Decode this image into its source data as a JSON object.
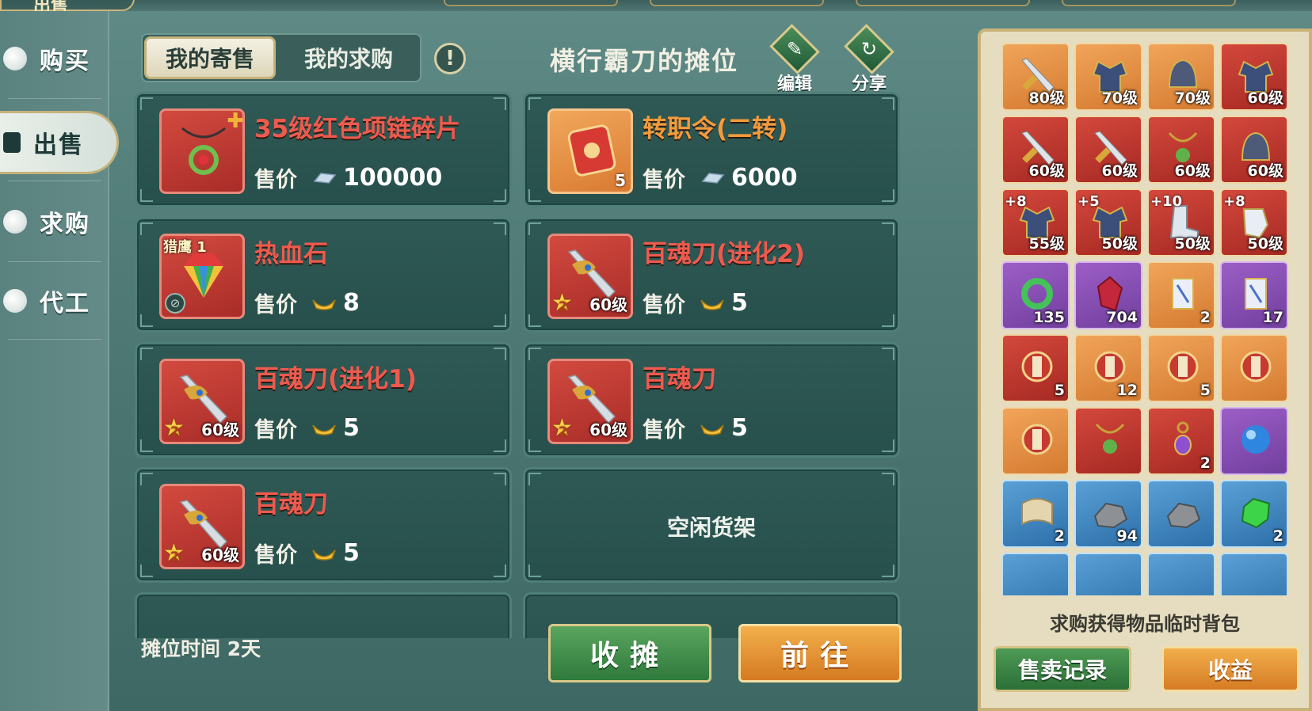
{
  "top_tab": "出售",
  "nav": [
    {
      "label": "购买"
    },
    {
      "label": "出售"
    },
    {
      "label": "求购"
    },
    {
      "label": "代工"
    }
  ],
  "tabs": {
    "my_sale": "我的寄售",
    "my_request": "我的求购"
  },
  "info": "!",
  "stall_title": "横行霸刀的摊位",
  "tools": {
    "edit": "编辑",
    "share": "分享"
  },
  "price_label": "售价",
  "listings": [
    {
      "name": "35级红色项链碎片",
      "price": "100000",
      "currency": "silver-ingot-icon"
    },
    {
      "name": "转职令(二转)",
      "price": "6000",
      "currency": "silver-ingot-icon",
      "count": "5"
    },
    {
      "name": "热血石",
      "price": "8",
      "currency": "gold-ingot-icon",
      "tag": "猎鹰 1"
    },
    {
      "name": "百魂刀(进化2)",
      "price": "5",
      "currency": "gold-ingot-icon",
      "level": "60级",
      "star": "2"
    },
    {
      "name": "百魂刀(进化1)",
      "price": "5",
      "currency": "gold-ingot-icon",
      "level": "60级",
      "star": "2"
    },
    {
      "name": "百魂刀",
      "price": "5",
      "currency": "gold-ingot-icon",
      "level": "60级",
      "star": "2"
    },
    {
      "name": "百魂刀",
      "price": "5",
      "currency": "gold-ingot-icon",
      "level": "60级",
      "star": "2"
    }
  ],
  "empty_shelf": "空闲货架",
  "stall_time": "摊位时间 2天",
  "buttons": {
    "close_stall": "收摊",
    "goto": "前往",
    "sale_record": "售卖记录",
    "income": "收益"
  },
  "temp_bag": "求购获得物品临时背包",
  "inventory": [
    {
      "label": "80级"
    },
    {
      "label": "70级"
    },
    {
      "label": "70级"
    },
    {
      "label": "60级"
    },
    {
      "label": "60级"
    },
    {
      "label": "60级"
    },
    {
      "label": "60级"
    },
    {
      "label": "60级"
    },
    {
      "label": "55级",
      "plus": "+8"
    },
    {
      "label": "50级",
      "plus": "+5"
    },
    {
      "label": "50级",
      "plus": "+10"
    },
    {
      "label": "50级",
      "plus": "+8"
    },
    {
      "label": "135"
    },
    {
      "label": "704"
    },
    {
      "label": "2"
    },
    {
      "label": "17"
    },
    {
      "label": "5"
    },
    {
      "label": "12"
    },
    {
      "label": "5"
    },
    {
      "label": ""
    },
    {
      "label": ""
    },
    {
      "label": ""
    },
    {
      "label": "2"
    },
    {
      "label": ""
    },
    {
      "label": "2"
    },
    {
      "label": "94"
    },
    {
      "label": ""
    },
    {
      "label": "2"
    }
  ],
  "colors": {
    "item_name_red": "#ef5a4e",
    "item_name_orange": "#f49b3c",
    "panel_bg": "#27504c",
    "accent_gold": "#c9b37a"
  }
}
